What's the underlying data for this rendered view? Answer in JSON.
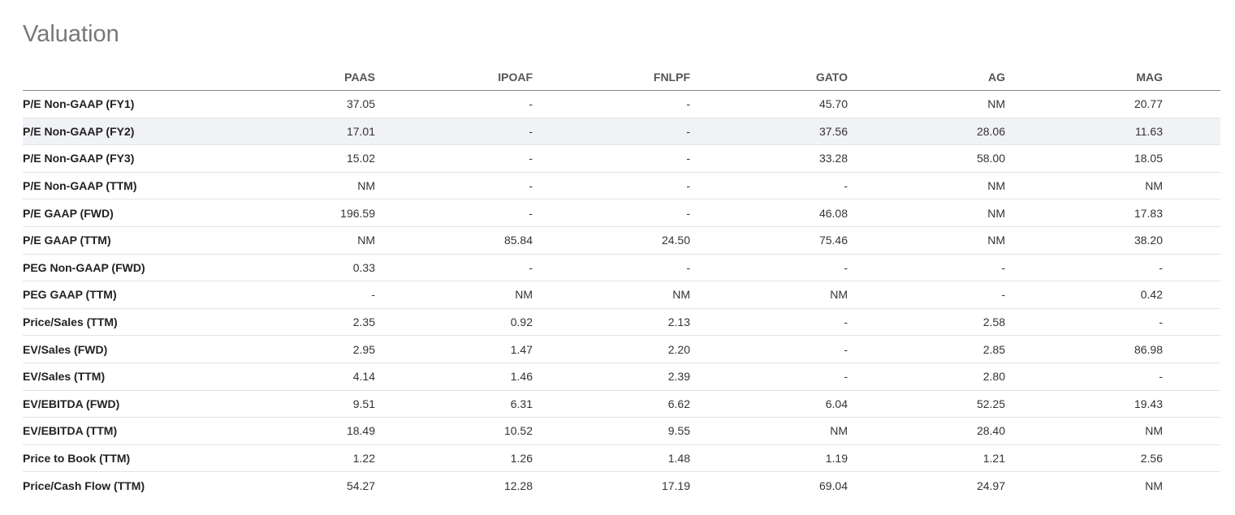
{
  "section": {
    "title": "Valuation"
  },
  "table": {
    "columns": [
      "PAAS",
      "IPOAF",
      "FNLPF",
      "GATO",
      "AG",
      "MAG"
    ],
    "rows": [
      {
        "label": "P/E Non-GAAP (FY1)",
        "values": [
          "37.05",
          "-",
          "-",
          "45.70",
          "NM",
          "20.77"
        ]
      },
      {
        "label": "P/E Non-GAAP (FY2)",
        "values": [
          "17.01",
          "-",
          "-",
          "37.56",
          "28.06",
          "11.63"
        ]
      },
      {
        "label": "P/E Non-GAAP (FY3)",
        "values": [
          "15.02",
          "-",
          "-",
          "33.28",
          "58.00",
          "18.05"
        ]
      },
      {
        "label": "P/E Non-GAAP (TTM)",
        "values": [
          "NM",
          "-",
          "-",
          "-",
          "NM",
          "NM"
        ]
      },
      {
        "label": "P/E GAAP (FWD)",
        "values": [
          "196.59",
          "-",
          "-",
          "46.08",
          "NM",
          "17.83"
        ]
      },
      {
        "label": "P/E GAAP (TTM)",
        "values": [
          "NM",
          "85.84",
          "24.50",
          "75.46",
          "NM",
          "38.20"
        ]
      },
      {
        "label": "PEG Non-GAAP (FWD)",
        "values": [
          "0.33",
          "-",
          "-",
          "-",
          "-",
          "-"
        ]
      },
      {
        "label": "PEG GAAP (TTM)",
        "values": [
          "-",
          "NM",
          "NM",
          "NM",
          "-",
          "0.42"
        ]
      },
      {
        "label": "Price/Sales (TTM)",
        "values": [
          "2.35",
          "0.92",
          "2.13",
          "-",
          "2.58",
          "-"
        ]
      },
      {
        "label": "EV/Sales (FWD)",
        "values": [
          "2.95",
          "1.47",
          "2.20",
          "-",
          "2.85",
          "86.98"
        ]
      },
      {
        "label": "EV/Sales (TTM)",
        "values": [
          "4.14",
          "1.46",
          "2.39",
          "-",
          "2.80",
          "-"
        ]
      },
      {
        "label": "EV/EBITDA (FWD)",
        "values": [
          "9.51",
          "6.31",
          "6.62",
          "6.04",
          "52.25",
          "19.43"
        ]
      },
      {
        "label": "EV/EBITDA (TTM)",
        "values": [
          "18.49",
          "10.52",
          "9.55",
          "NM",
          "28.40",
          "NM"
        ]
      },
      {
        "label": "Price to Book (TTM)",
        "values": [
          "1.22",
          "1.26",
          "1.48",
          "1.19",
          "1.21",
          "2.56"
        ]
      },
      {
        "label": "Price/Cash Flow (TTM)",
        "values": [
          "54.27",
          "12.28",
          "17.19",
          "69.04",
          "24.97",
          "NM"
        ]
      }
    ],
    "highlighted_row": 1
  },
  "colors": {
    "title": "#777777",
    "header_text": "#555555",
    "row_highlight": "#f1f2f6",
    "divider": "#e3e3e3"
  }
}
